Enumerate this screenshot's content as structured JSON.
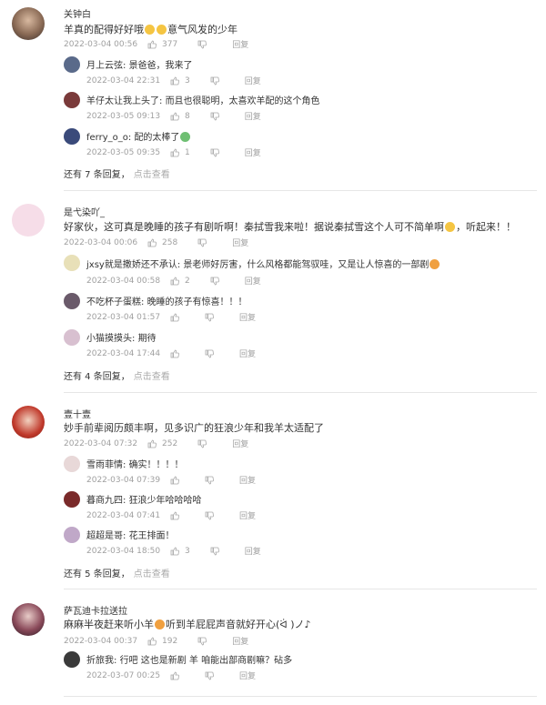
{
  "comments": [
    {
      "user": "关钟白",
      "text": "羊真的配得好好哦",
      "text_suffix": "意气风发的少年",
      "date": "2022-03-04 00:56",
      "likes": "377",
      "reply": "回复",
      "replies": [
        {
          "user": "月上云弦",
          "text": "景爸爸，我来了",
          "date": "2022-03-04 22:31",
          "likes": "3",
          "reply": "回复"
        },
        {
          "user": "羊仔太让我上头了",
          "text": "而且也很聪明，太喜欢羊配的这个角色",
          "date": "2022-03-05 09:13",
          "likes": "8",
          "reply": "回复"
        },
        {
          "user": "ferry_o_o",
          "text": "配的太棒了",
          "date": "2022-03-05 09:35",
          "likes": "1",
          "reply": "回复"
        }
      ],
      "more_count": "还有 7 条回复，",
      "more_link": "点击查看"
    },
    {
      "user": "是弋染吖_",
      "text": "好家伙，这可真是晚睡的孩子有剧听啊！秦拭雪我来啦！据说秦拭雪这个人可不简单啊",
      "text_suffix": "，听起来！！",
      "date": "2022-03-04 00:06",
      "likes": "258",
      "reply": "回复",
      "replies": [
        {
          "user": "jxsy就是撒娇还不承认",
          "text": "景老师好厉害，什么风格都能驾驭哇，又是让人惊喜的一部剧",
          "date": "2022-03-04 00:58",
          "likes": "2",
          "reply": "回复"
        },
        {
          "user": "不吃杯子蛋糕",
          "text": "晚睡的孩子有惊喜！！！",
          "date": "2022-03-04 01:57",
          "likes": "",
          "reply": "回复"
        },
        {
          "user": "小猫摸摸头",
          "text": "期待",
          "date": "2022-03-04 17:44",
          "likes": "",
          "reply": "回复"
        }
      ],
      "more_count": "还有 4 条回复，",
      "more_link": "点击查看"
    },
    {
      "user": "壹十壹",
      "text": "妙手前辈阅历颇丰啊，见多识广的狂浪少年和我羊太适配了",
      "text_suffix": "",
      "date": "2022-03-04 07:32",
      "likes": "252",
      "reply": "回复",
      "replies": [
        {
          "user": "雪雨菲情",
          "text": "确实！！！！",
          "date": "2022-03-04 07:39",
          "likes": "",
          "reply": "回复"
        },
        {
          "user": "暮商九四",
          "text": "狂浪少年哈哈哈哈",
          "date": "2022-03-04 07:41",
          "likes": "",
          "reply": "回复"
        },
        {
          "user": "超超是哥",
          "text": "花王排面！",
          "date": "2022-03-04 18:50",
          "likes": "3",
          "reply": "回复"
        }
      ],
      "more_count": "还有 5 条回复，",
      "more_link": "点击查看"
    },
    {
      "user": "萨瓦迪卡拉送拉",
      "text": "麻麻半夜赶来听小羊",
      "text_suffix": "听到羊屁屁声音就好开心(ᐛ )ノ♪",
      "date": "2022-03-04 00:37",
      "likes": "192",
      "reply": "回复",
      "replies": [
        {
          "user": "折旅我",
          "text": "行吧 这也是新剧 羊 咱能出部商剧嘛？砧多",
          "date": "2022-03-07 00:25",
          "likes": "",
          "reply": "回复"
        }
      ],
      "more_count": "",
      "more_link": ""
    }
  ],
  "colors": {
    "text": "#333333",
    "meta": "#a0a0a0",
    "separator": "#e6e6e6"
  },
  "icons": {
    "like": "thumb-up-icon",
    "dislike": "thumb-down-icon"
  }
}
